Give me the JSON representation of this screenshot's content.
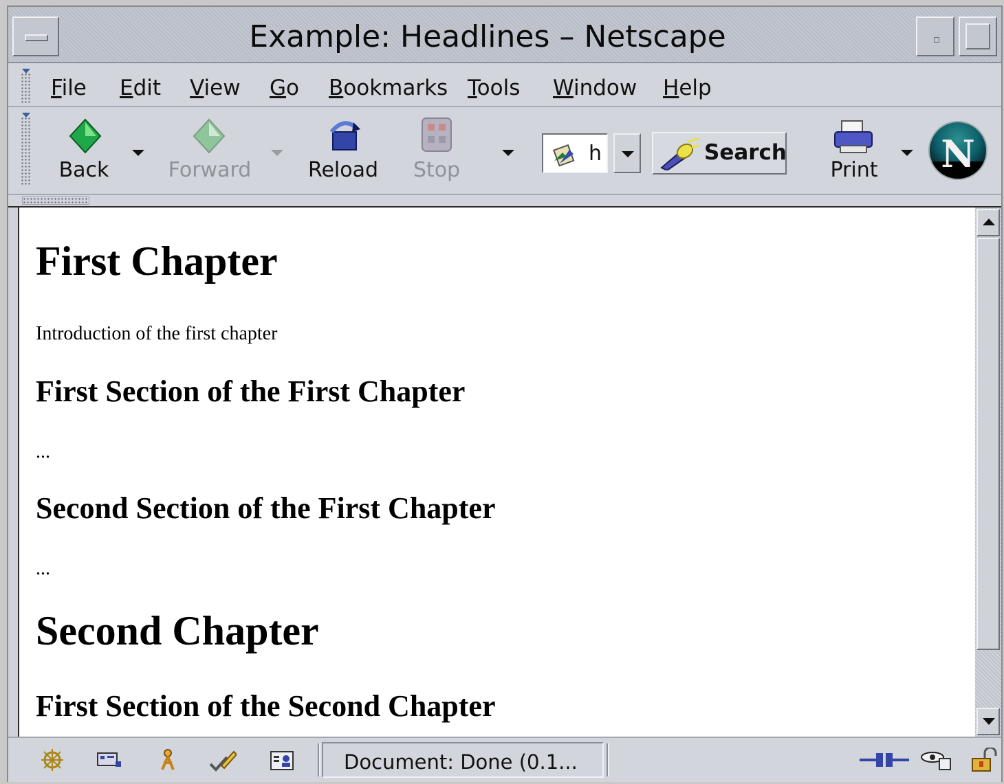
{
  "window": {
    "title": "Example: Headlines – Netscape"
  },
  "menubar": {
    "items": [
      {
        "mnemonic": "F",
        "rest": "ile"
      },
      {
        "mnemonic": "E",
        "rest": "dit"
      },
      {
        "mnemonic": "V",
        "rest": "iew"
      },
      {
        "mnemonic": "G",
        "rest": "o"
      },
      {
        "mnemonic": "B",
        "rest": "ookmarks"
      },
      {
        "mnemonic": "T",
        "rest": "ools"
      },
      {
        "mnemonic": "W",
        "rest": "indow"
      },
      {
        "mnemonic": "H",
        "rest": "elp"
      }
    ]
  },
  "toolbar": {
    "back": {
      "label": "Back",
      "icon": "back-arrow-icon"
    },
    "forward": {
      "label": "Forward",
      "icon": "forward-arrow-icon",
      "disabled": true
    },
    "reload": {
      "label": "Reload",
      "icon": "reload-icon"
    },
    "stop": {
      "label": "Stop",
      "icon": "stop-icon",
      "disabled": true
    },
    "url_value": "h",
    "search": {
      "label": "Search",
      "icon": "search-flashlight-icon"
    },
    "print": {
      "label": "Print",
      "icon": "printer-icon"
    },
    "logo": {
      "letter": "N",
      "icon": "netscape-logo-icon"
    }
  },
  "document": {
    "h1_first": "First Chapter",
    "intro": "Introduction of the first chapter",
    "h2_first_first": "First Section of the First Chapter",
    "ellipsis1": "...",
    "h2_second_first": "Second Section of the First Chapter",
    "ellipsis2": "...",
    "h1_second": "Second Chapter",
    "h2_first_second": "First Section of the Second Chapter"
  },
  "statusbar": {
    "text": "Document: Done (0.1...",
    "left_icons": [
      "navigator-icon",
      "mail-icon",
      "instant-messenger-icon",
      "composer-icon",
      "address-book-icon"
    ],
    "right_icons": [
      "online-connection-icon",
      "security-eye-icon",
      "lock-icon"
    ]
  }
}
